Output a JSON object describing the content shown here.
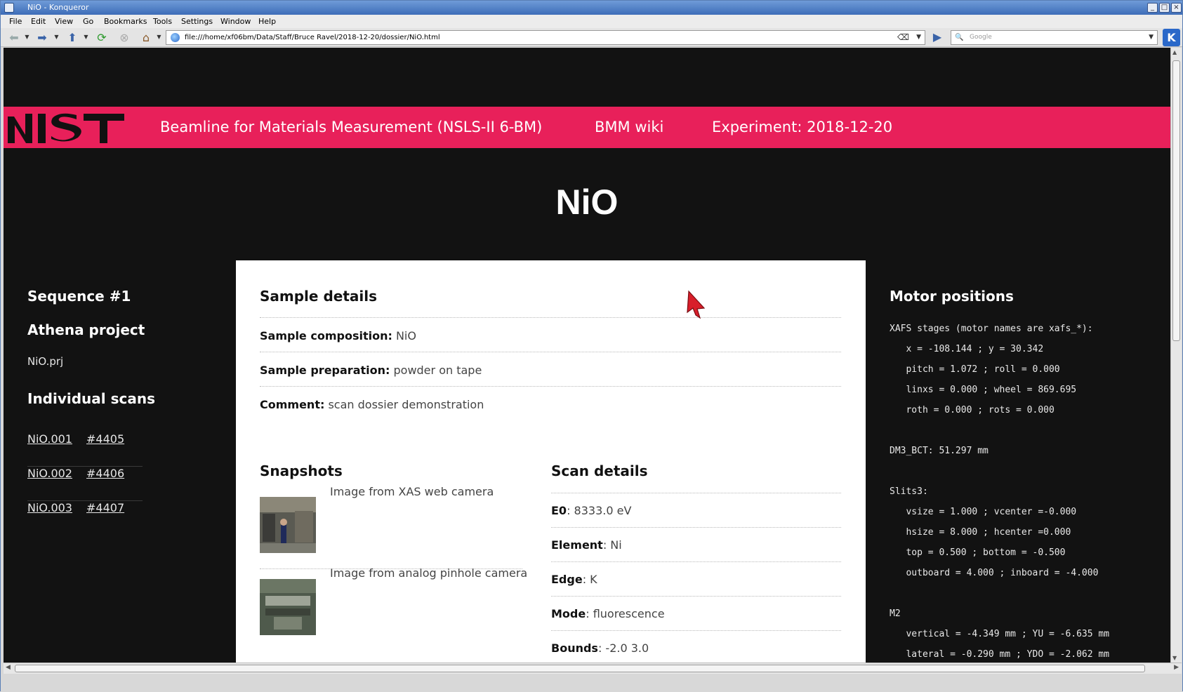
{
  "window": {
    "title": "NiO - Konqueror",
    "buttons": [
      "_",
      "□",
      "×"
    ]
  },
  "menu": [
    "File",
    "Edit",
    "View",
    "Go",
    "Bookmarks",
    "Tools",
    "Settings",
    "Window",
    "Help"
  ],
  "toolbar": {
    "url": "file:///home/xf06bm/Data/Staff/Bruce Ravel/2018-12-20/dossier/NiO.html",
    "search_placeholder": "Google",
    "konq_logo": "K"
  },
  "colors": {
    "banner": "#e8205a",
    "page_bg": "#121212",
    "card_bg": "#ffffff"
  },
  "banner": {
    "logo_text": "NIST",
    "links": [
      {
        "label": "Beamline for Materials Measurement (NSLS-II 6-BM)"
      },
      {
        "label": "BMM wiki"
      },
      {
        "label": "Experiment: 2018-12-20"
      }
    ]
  },
  "page_title": "NiO",
  "left": {
    "sequence": "Sequence #1",
    "athena_heading": "Athena project",
    "athena_file": "NiO.prj",
    "scans_heading": "Individual scans",
    "scans": [
      {
        "file": "NiO.001",
        "num": "#4405"
      },
      {
        "file": "NiO.002",
        "num": "#4406"
      },
      {
        "file": "NiO.003",
        "num": "#4407"
      }
    ]
  },
  "sample": {
    "heading": "Sample details",
    "rows": [
      {
        "key": "Sample composition:",
        "value": " NiO"
      },
      {
        "key": "Sample preparation:",
        "value": " powder on tape"
      },
      {
        "key": "Comment:",
        "value": " scan dossier demonstration"
      }
    ]
  },
  "snapshots": {
    "heading": "Snapshots",
    "items": [
      {
        "caption": "Image from XAS web camera"
      },
      {
        "caption": "Image from analog pinhole camera"
      }
    ]
  },
  "scan_details": {
    "heading": "Scan details",
    "rows": [
      {
        "key": "E0",
        "value": ": 8333.0 eV"
      },
      {
        "key": "Element",
        "value": ": Ni"
      },
      {
        "key": "Edge",
        "value": ": K"
      },
      {
        "key": "Mode",
        "value": ": fluorescence"
      },
      {
        "key": "Bounds",
        "value": ": -2.0 3.0"
      }
    ]
  },
  "motors": {
    "heading": "Motor positions",
    "lines": [
      "XAFS stages (motor names are xafs_*):",
      "   x = -108.144 ; y = 30.342",
      "   pitch = 1.072 ; roll = 0.000",
      "   linxs = 0.000 ; wheel = 869.695",
      "   roth = 0.000 ; rots = 0.000",
      "",
      "DM3_BCT: 51.297 mm",
      "",
      "Slits3:",
      "   vsize = 1.000 ; vcenter =-0.000",
      "   hsize = 8.000 ; hcenter =0.000",
      "   top = 0.500 ; bottom = -0.500",
      "   outboard = 4.000 ; inboard = -4.000",
      "",
      "M2",
      "   vertical = -4.349 mm ; YU = -6.635 mm",
      "   lateral = -0.290 mm ; YDO = -2.062 mm"
    ]
  }
}
